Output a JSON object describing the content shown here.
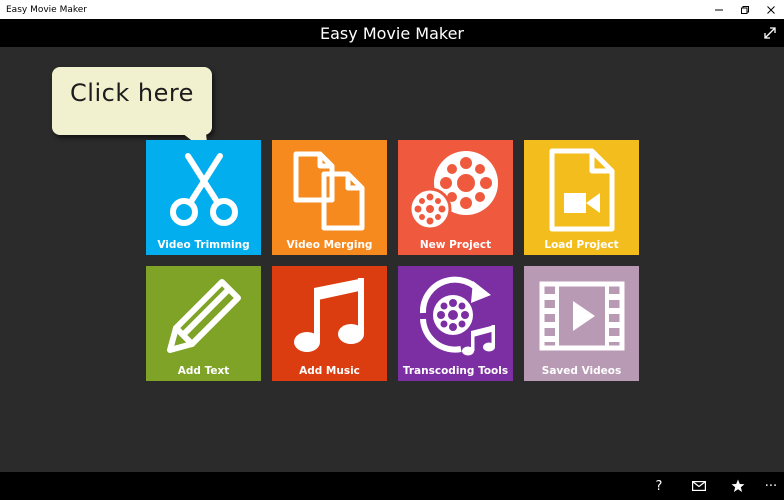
{
  "window": {
    "title": "Easy Movie Maker",
    "controls": [
      "minimize",
      "restore",
      "close"
    ]
  },
  "header": {
    "title": "Easy Movie Maker",
    "expand_icon": "fullscreen-expand-icon"
  },
  "tooltip": {
    "text": "Click here"
  },
  "tiles": [
    {
      "label": "Video Trimming",
      "icon": "scissors-icon",
      "color": "#03aeef"
    },
    {
      "label": "Video Merging",
      "icon": "documents-icon",
      "color": "#f68a1e"
    },
    {
      "label": "New Project",
      "icon": "film-reel-icon",
      "color": "#ef5a3f"
    },
    {
      "label": "Load Project",
      "icon": "video-file-icon",
      "color": "#f3bd1e"
    },
    {
      "label": "Add Text",
      "icon": "pencil-icon",
      "color": "#7ea326"
    },
    {
      "label": "Add Music",
      "icon": "music-note-icon",
      "color": "#db3d10"
    },
    {
      "label": "Transcoding Tools",
      "icon": "transcode-reel-icon",
      "color": "#7b2fa3"
    },
    {
      "label": "Saved Videos",
      "icon": "filmstrip-play-icon",
      "color": "#b89ab5"
    }
  ],
  "commandbar": {
    "help_glyph": "?",
    "more_glyph": "···",
    "icons": [
      "help-icon",
      "mail-icon",
      "star-icon",
      "more-icon"
    ]
  }
}
